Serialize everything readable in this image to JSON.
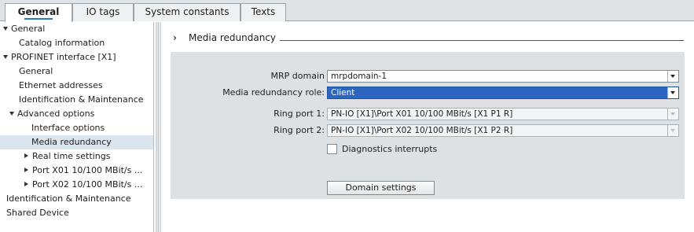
{
  "tabs": [
    {
      "label": "General",
      "active": true
    },
    {
      "label": "IO tags",
      "active": false
    },
    {
      "label": "System constants",
      "active": false
    },
    {
      "label": "Texts",
      "active": false
    }
  ],
  "nav": {
    "items": [
      {
        "label": "General",
        "expander": "expanded",
        "level": 0,
        "selected": false
      },
      {
        "label": "Catalog information",
        "expander": "none",
        "level": 1,
        "selected": false
      },
      {
        "label": "PROFINET interface [X1]",
        "expander": "expanded",
        "level": 0,
        "selected": false
      },
      {
        "label": "General",
        "expander": "none",
        "level": 1,
        "selected": false
      },
      {
        "label": "Ethernet addresses",
        "expander": "none",
        "level": 1,
        "selected": false
      },
      {
        "label": "Identification & Maintenance",
        "expander": "none",
        "level": 1,
        "selected": false
      },
      {
        "label": "Advanced options",
        "expander": "expanded",
        "level": 1,
        "selected": false
      },
      {
        "label": "Interface options",
        "expander": "none",
        "level": 2,
        "selected": false
      },
      {
        "label": "Media redundancy",
        "expander": "none",
        "level": 2,
        "selected": true
      },
      {
        "label": "Real time settings",
        "expander": "collapsed",
        "level": 2,
        "selected": false
      },
      {
        "label": "Port X01 10/100 MBit/s ...",
        "expander": "collapsed",
        "level": 2,
        "selected": false
      },
      {
        "label": "Port X02 10/100 MBit/s ...",
        "expander": "collapsed",
        "level": 2,
        "selected": false
      },
      {
        "label": "Identification & Maintenance",
        "expander": "none",
        "level": 0,
        "selected": false
      },
      {
        "label": "Shared Device",
        "expander": "none",
        "level": 0,
        "selected": false
      }
    ]
  },
  "section": {
    "title": "Media redundancy"
  },
  "form": {
    "mrp_domain": {
      "label": "MRP domain",
      "value": "mrpdomain-1"
    },
    "role": {
      "label": "Media redundancy role:",
      "value": "Client"
    },
    "ring_port_1": {
      "label": "Ring port 1:",
      "value": "PN-IO [X1]\\Port X01 10/100 MBit/s [X1 P1 R]"
    },
    "ring_port_2": {
      "label": "Ring port 2:",
      "value": "PN-IO [X1]\\Port X02 10/100 MBit/s [X1 P2 R]"
    },
    "diagnostics": {
      "label": "Diagnostics interrupts",
      "checked": false
    },
    "domain_settings_label": "Domain settings"
  },
  "colors": {
    "accent": "#2b7bb9",
    "selection": "#2d66c1",
    "panel": "#dde1e4",
    "nav_selected": "#dbe5ee"
  }
}
